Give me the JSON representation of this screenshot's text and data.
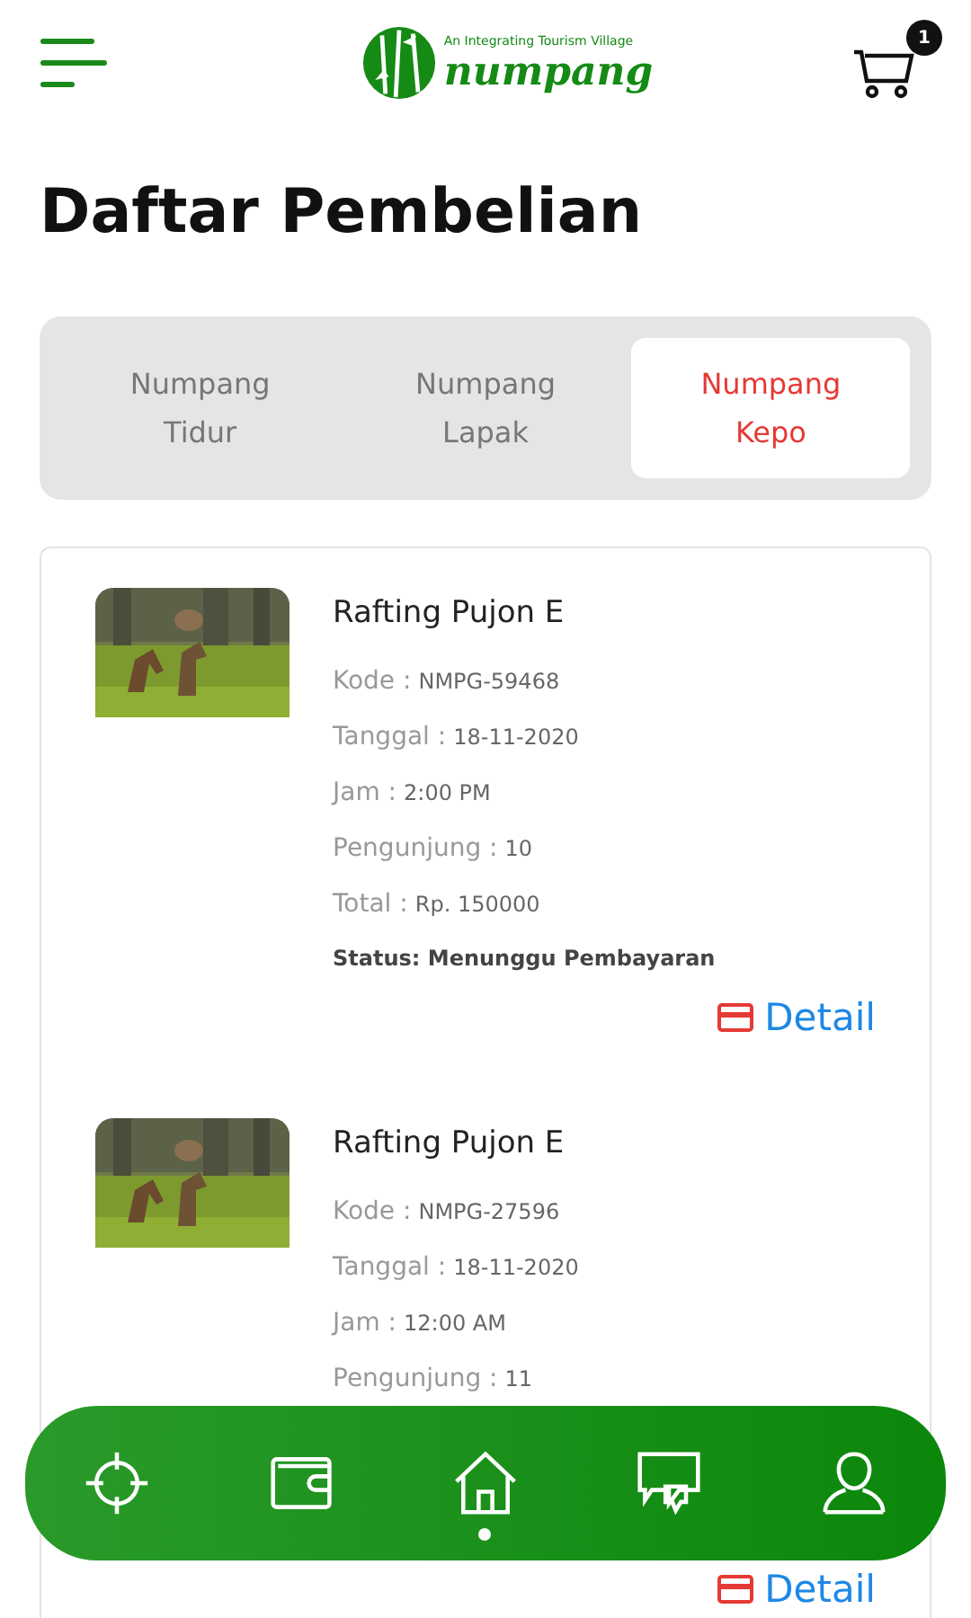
{
  "header": {
    "logo_tagline": "An Integrating Tourism Village",
    "logo_name": "numpang",
    "cart_count": "1"
  },
  "title": "Daftar Pembelian",
  "tabs": [
    {
      "label": "Numpang Tidur",
      "selected": false
    },
    {
      "label": "Numpang Lapak",
      "selected": false
    },
    {
      "label": "Numpang Kepo",
      "selected": true
    }
  ],
  "orders": [
    {
      "name": "Rafting Pujon E",
      "details": [
        {
          "label": "Kode :",
          "value": "NMPG-59468"
        },
        {
          "label": "Tanggal :",
          "value": "18-11-2020"
        },
        {
          "label": "Jam :",
          "value": "2:00 PM"
        },
        {
          "label": "Pengunjung :",
          "value": "10"
        },
        {
          "label": "Total :",
          "value": "Rp. 150000"
        }
      ],
      "status": "Status: Menunggu Pembayaran",
      "action": "Detail"
    },
    {
      "name": "Rafting Pujon E",
      "details": [
        {
          "label": "Kode :",
          "value": "NMPG-27596"
        },
        {
          "label": "Tanggal :",
          "value": "18-11-2020"
        },
        {
          "label": "Jam :",
          "value": "12:00 AM"
        },
        {
          "label": "Pengunjung :",
          "value": "11"
        }
      ],
      "action": "Detail"
    }
  ],
  "nav": [
    {
      "kind": "target",
      "selected": false
    },
    {
      "kind": "wallet",
      "selected": false
    },
    {
      "kind": "home",
      "selected": true
    },
    {
      "kind": "chat",
      "selected": false
    },
    {
      "kind": "user",
      "selected": false
    }
  ]
}
